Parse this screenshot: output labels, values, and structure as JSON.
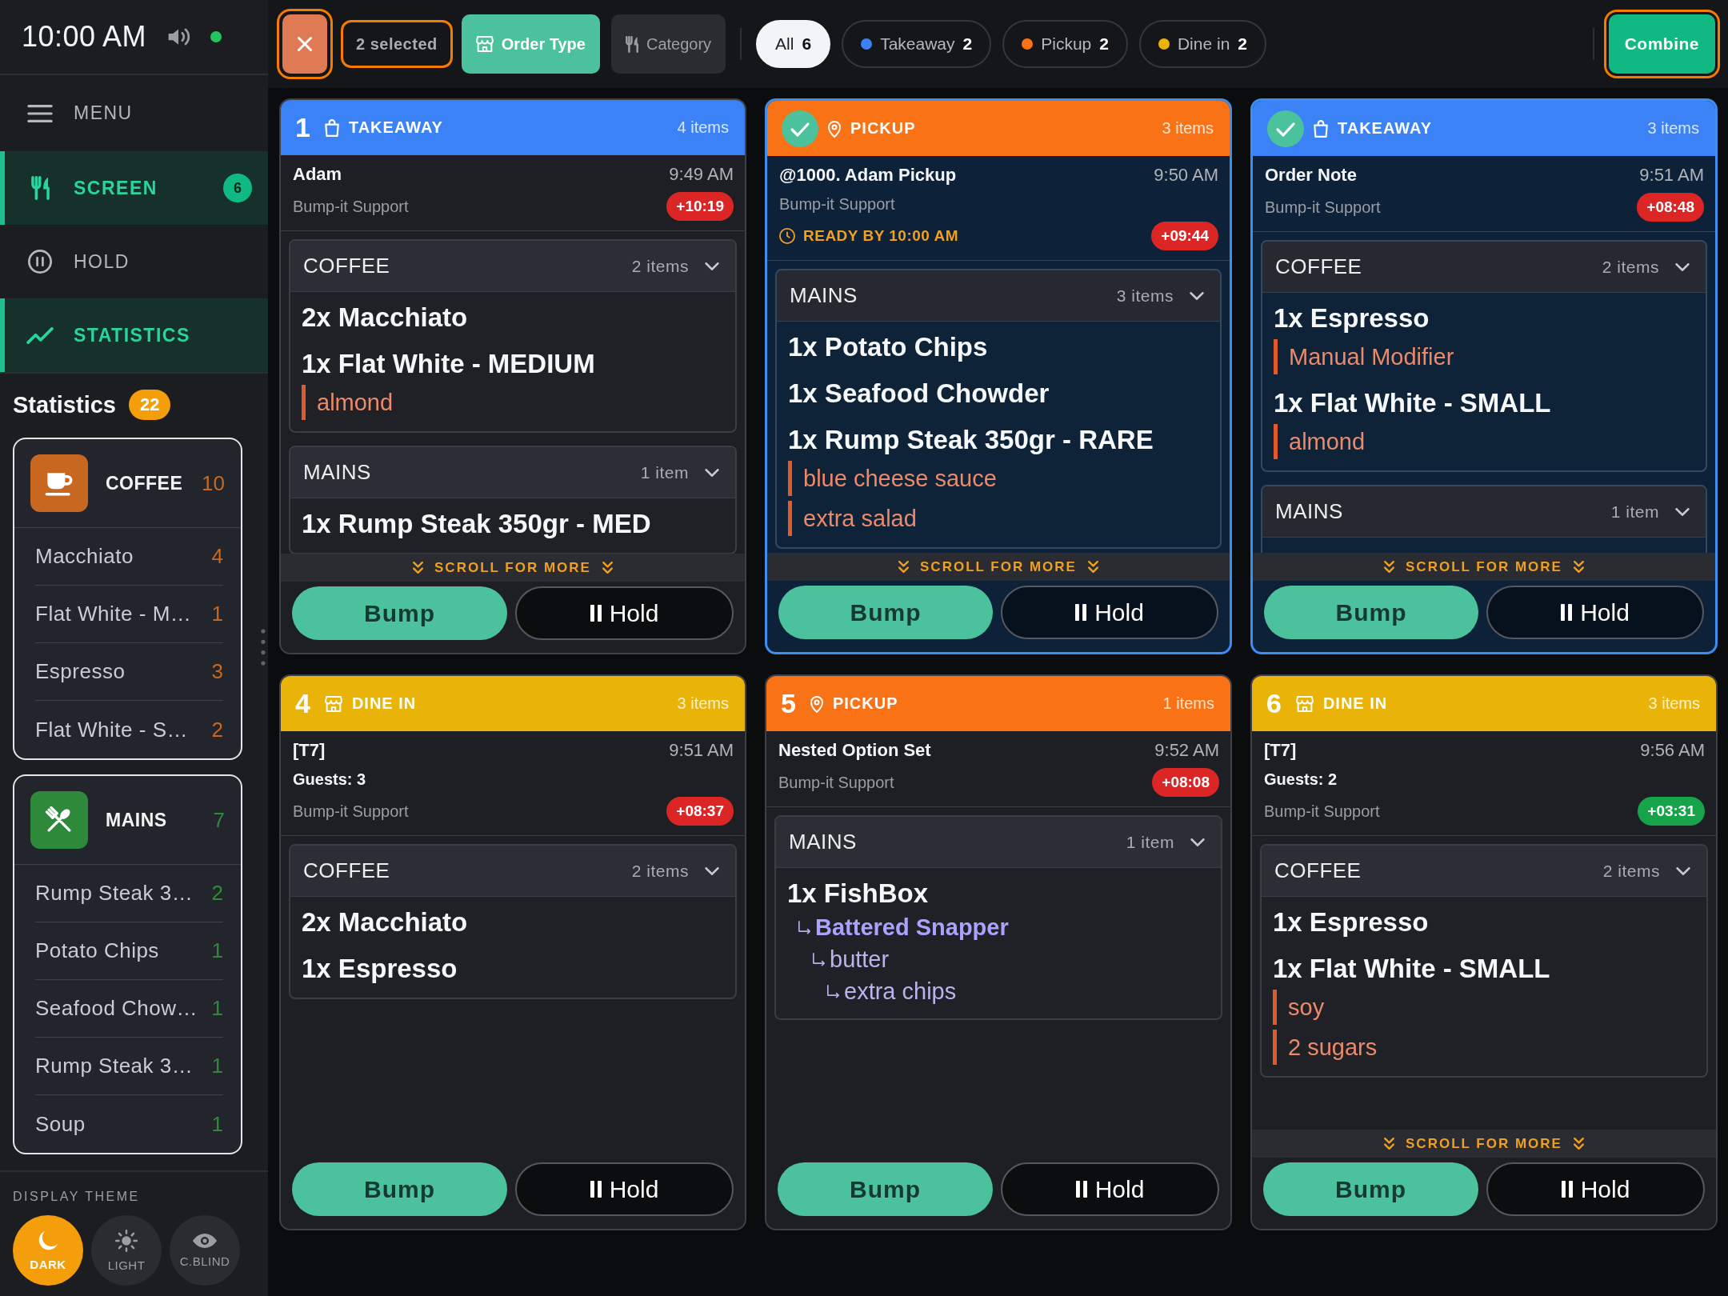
{
  "status_bar": {
    "time": "10:00 AM",
    "connected": true
  },
  "sidebar": {
    "menu_label": "MENU",
    "items": [
      {
        "label": "SCREEN",
        "badge": "6",
        "selected": true
      },
      {
        "label": "HOLD",
        "selected": false
      },
      {
        "label": "STATISTICS",
        "selected": true
      }
    ]
  },
  "statistics": {
    "title": "Statistics",
    "total": "22",
    "categories": [
      {
        "name": "COFFEE",
        "count": "10",
        "color": "#c8671f",
        "items": [
          {
            "name": "Macchiato",
            "count": "4"
          },
          {
            "name": "Flat White - M…",
            "count": "1"
          },
          {
            "name": "Espresso",
            "count": "3"
          },
          {
            "name": "Flat White - S…",
            "count": "2"
          }
        ]
      },
      {
        "name": "MAINS",
        "count": "7",
        "color": "#2e8a3a",
        "items": [
          {
            "name": "Rump Steak 3…",
            "count": "2"
          },
          {
            "name": "Potato Chips",
            "count": "1"
          },
          {
            "name": "Seafood Chow…",
            "count": "1"
          },
          {
            "name": "Rump Steak 3…",
            "count": "1"
          },
          {
            "name": "Soup",
            "count": "1"
          }
        ]
      }
    ]
  },
  "display_theme": {
    "title": "DISPLAY THEME",
    "options": [
      {
        "label": "DARK",
        "selected": true
      },
      {
        "label": "LIGHT",
        "selected": false
      },
      {
        "label": "C.BLIND",
        "selected": false
      }
    ]
  },
  "toolbar": {
    "clear_selection": {
      "highlighted": true
    },
    "selection_count": {
      "text": "2 selected",
      "highlighted": true
    },
    "group_by": [
      {
        "label": "Order Type",
        "selected": true
      },
      {
        "label": "Category",
        "selected": false
      }
    ],
    "filters": [
      {
        "label": "All",
        "count": "6",
        "selected": true
      },
      {
        "label": "Takeaway",
        "count": "2",
        "selected": false,
        "color": "#3b82f6"
      },
      {
        "label": "Pickup",
        "count": "2",
        "selected": false,
        "color": "#f97316"
      },
      {
        "label": "Dine in",
        "count": "2",
        "selected": false,
        "color": "#eab308"
      }
    ],
    "combine": {
      "label": "Combine",
      "highlighted": true
    }
  },
  "orders": [
    {
      "kind": "takeaway",
      "number": "1",
      "type": "TAKEAWAY",
      "color": "#3b82f6",
      "selected": false,
      "item_count": "4 items",
      "name": "Adam",
      "time": "9:49 AM",
      "source": "Bump-it Support",
      "timer": {
        "text": "+10:19",
        "color": "#dc2626"
      },
      "groups": [
        {
          "name": "COFFEE",
          "count": "2 items",
          "expanded": true,
          "items": [
            {
              "text": "2x Macchiato"
            },
            {
              "text": "1x Flat White - MEDIUM",
              "modifiers": [
                "almond"
              ]
            }
          ]
        },
        {
          "name": "MAINS",
          "count": "1 item",
          "expanded": true,
          "items": [
            {
              "text": "1x Rump Steak 350gr - MED"
            }
          ]
        }
      ],
      "scroll_hint": "SCROLL FOR MORE",
      "bump_label": "Bump",
      "hold_label": "Hold"
    },
    {
      "kind": "pickup",
      "type": "PICKUP",
      "color": "#f97316",
      "selected": true,
      "item_count": "3 items",
      "name": "@1000. Adam Pickup",
      "time": "9:50 AM",
      "source": "Bump-it Support",
      "ready_by": "READY BY 10:00 AM",
      "timer": {
        "text": "+09:44",
        "color": "#dc2626"
      },
      "groups": [
        {
          "name": "MAINS",
          "count": "3 items",
          "expanded": true,
          "items": [
            {
              "text": "1x Potato Chips"
            },
            {
              "text": "1x Seafood Chowder"
            },
            {
              "text": "1x Rump Steak 350gr - RARE",
              "modifiers": [
                "blue cheese sauce",
                "extra salad"
              ]
            }
          ]
        }
      ],
      "scroll_hint": "SCROLL FOR MORE",
      "bump_label": "Bump",
      "hold_label": "Hold"
    },
    {
      "kind": "takeaway",
      "type": "TAKEAWAY",
      "color": "#3b82f6",
      "selected": true,
      "item_count": "3 items",
      "name": "Order Note",
      "time": "9:51 AM",
      "source": "Bump-it Support",
      "timer": {
        "text": "+08:48",
        "color": "#dc2626"
      },
      "groups": [
        {
          "name": "COFFEE",
          "count": "2 items",
          "expanded": true,
          "items": [
            {
              "text": "1x Espresso",
              "modifiers": [
                "Manual Modifier"
              ]
            },
            {
              "text": "1x Flat White - SMALL",
              "modifiers": [
                "almond"
              ]
            }
          ]
        },
        {
          "name": "MAINS",
          "count": "1 item",
          "expanded": true
        }
      ],
      "scroll_hint": "SCROLL FOR MORE",
      "bump_label": "Bump",
      "hold_label": "Hold"
    },
    {
      "kind": "dine_in",
      "number": "4",
      "type": "DINE IN",
      "color": "#eab308",
      "selected": false,
      "item_count": "3 items",
      "name": "[T7]",
      "time": "9:51 AM",
      "guests": "Guests: 3",
      "source": "Bump-it Support",
      "timer": {
        "text": "+08:37",
        "color": "#dc2626"
      },
      "groups": [
        {
          "name": "COFFEE",
          "count": "2 items",
          "expanded": true,
          "items": [
            {
              "text": "2x Macchiato"
            },
            {
              "text": "1x Espresso"
            }
          ]
        }
      ],
      "bump_label": "Bump",
      "hold_label": "Hold"
    },
    {
      "kind": "pickup",
      "number": "5",
      "type": "PICKUP",
      "color": "#f97316",
      "selected": false,
      "item_count": "1 items",
      "name": "Nested Option Set",
      "time": "9:52 AM",
      "source": "Bump-it Support",
      "timer": {
        "text": "+08:08",
        "color": "#dc2626"
      },
      "groups": [
        {
          "name": "MAINS",
          "count": "1 item",
          "expanded": true,
          "items": [
            {
              "text": "1x FishBox",
              "options": [
                {
                  "text": "Battered Snapper",
                  "children": [
                    {
                      "text": "butter",
                      "children": [
                        {
                          "text": "extra chips"
                        }
                      ]
                    }
                  ]
                }
              ]
            }
          ]
        }
      ],
      "bump_label": "Bump",
      "hold_label": "Hold"
    },
    {
      "kind": "dine_in",
      "number": "6",
      "type": "DINE IN",
      "color": "#eab308",
      "selected": false,
      "item_count": "3 items",
      "name": "[T7]",
      "time": "9:56 AM",
      "guests": "Guests: 2",
      "source": "Bump-it Support",
      "timer": {
        "text": "+03:31",
        "color": "#16a34a"
      },
      "groups": [
        {
          "name": "COFFEE",
          "count": "2 items",
          "expanded": true,
          "items": [
            {
              "text": "1x Espresso"
            },
            {
              "text": "1x Flat White - SMALL",
              "modifiers": [
                "soy",
                "2 sugars"
              ]
            }
          ]
        }
      ],
      "scroll_hint": "SCROLL FOR MORE",
      "bump_label": "Bump",
      "hold_label": "Hold"
    }
  ]
}
